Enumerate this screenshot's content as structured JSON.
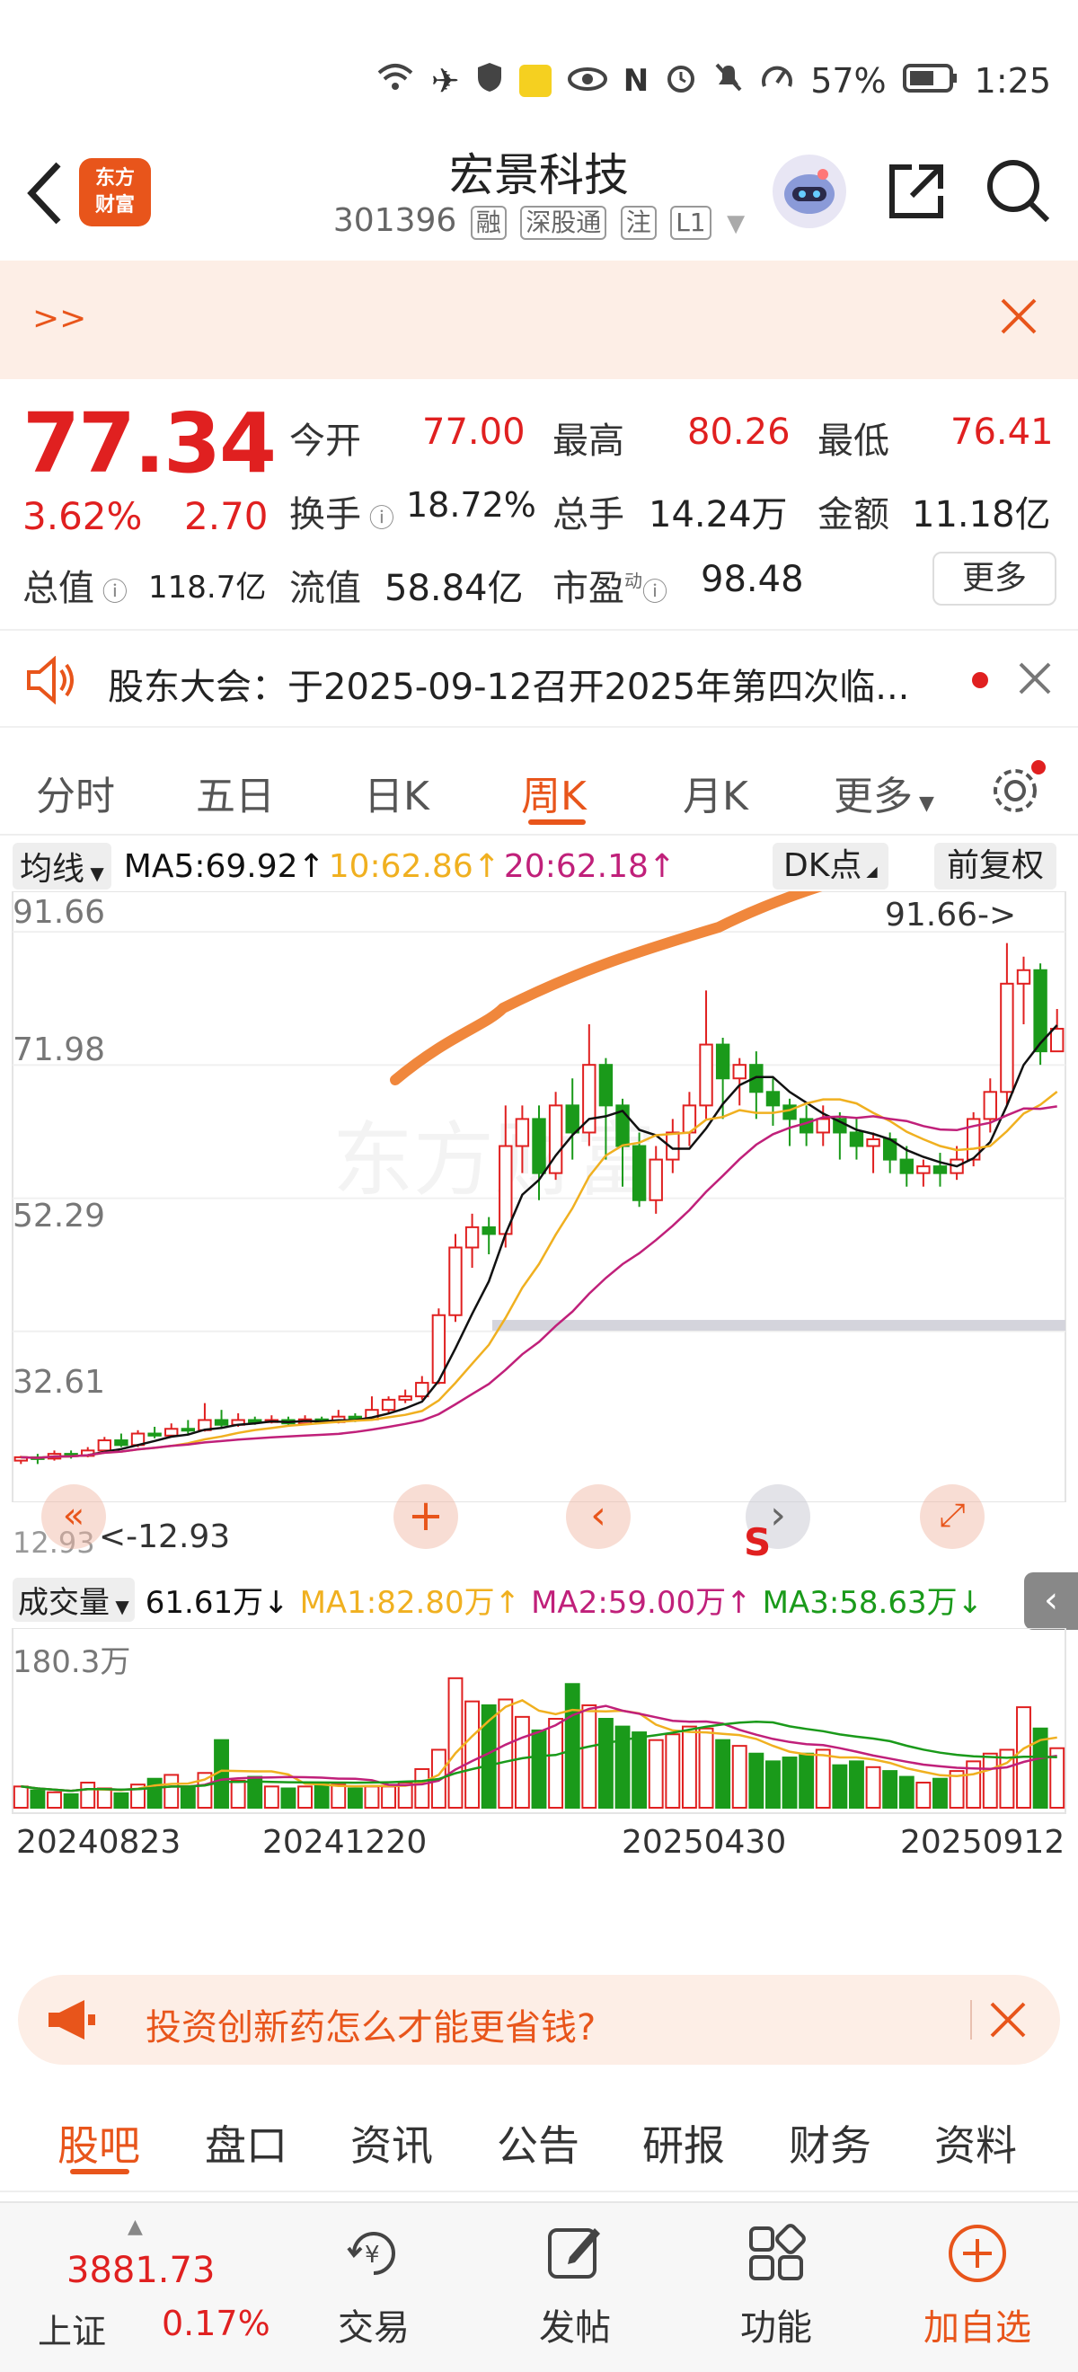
{
  "status_bar": {
    "battery": "57%",
    "time": "1:25"
  },
  "header": {
    "stock_name": "宏景科技",
    "stock_code": "301396",
    "tags": [
      "融",
      "深股通",
      "注",
      "L1"
    ],
    "logo_text": "东方财富"
  },
  "promo": {
    "text": ">>"
  },
  "quote": {
    "price": "77.34",
    "change_pct": "3.62%",
    "change": "2.70",
    "open_label": "今开",
    "open": "77.00",
    "high_label": "最高",
    "high": "80.26",
    "low_label": "最低",
    "low": "76.41",
    "turnover_label": "换手",
    "turnover": "18.72%",
    "volume_label": "总手",
    "volume": "14.24万",
    "amount_label": "金额",
    "amount": "11.18亿",
    "mktcap_label": "总值",
    "mktcap": "118.7亿",
    "float_label": "流值",
    "float": "58.84亿",
    "pe_label": "市盈",
    "pe_sup": "动",
    "pe": "98.48",
    "more": "更多"
  },
  "notice": {
    "text": "股东大会：于2025-09-12召开2025年第四次临..."
  },
  "tabs": [
    "分时",
    "五日",
    "日K",
    "周K",
    "月K",
    "更多"
  ],
  "active_tab": "周K",
  "chart_header": {
    "indicator": "均线",
    "ma5": "MA5:69.92↑",
    "ma10": "10:62.86↑",
    "ma20": "20:62.18↑",
    "dk": "DK点",
    "adjust": "前复权"
  },
  "price_axis": [
    "91.66",
    "71.98",
    "52.29",
    "32.61"
  ],
  "annotations": {
    "high_marker": "91.66->",
    "low_marker": "<-12.93",
    "low_value": "12.93",
    "signal": "S"
  },
  "volume_header": {
    "label": "成交量",
    "value": "61.61万↓",
    "ma1": "MA1:82.80万↑",
    "ma2": "MA2:59.00万↑",
    "ma3": "MA3:58.63万↓"
  },
  "volume_axis": "180.3万",
  "date_axis": [
    "20240823",
    "20241220",
    "20250430",
    "20250912"
  ],
  "ad_bar": {
    "text": "投资创新药怎么才能更省钱?"
  },
  "bottom_tabs": [
    "股吧",
    "盘口",
    "资讯",
    "公告",
    "研报",
    "财务",
    "资料"
  ],
  "active_bottom_tab": "股吧",
  "nav": {
    "index_value": "3881.73",
    "index_name": "上证",
    "index_change": "0.17%",
    "trade": "交易",
    "post": "发帖",
    "function": "功能",
    "add": "加自选"
  },
  "colors": {
    "up": "#e02020",
    "down": "#1a9a1a",
    "accent": "#e8551b",
    "ma5": "#111111",
    "ma10": "#f0b020",
    "ma20": "#c0207a",
    "trend": "#f0873c"
  },
  "chart_data": {
    "type": "candlestick",
    "period": "weekly",
    "y_range": [
      12.93,
      91.66
    ],
    "x_labels": [
      "20240823",
      "20241220",
      "20250430",
      "20250912"
    ],
    "candles": [
      [
        13.5,
        14,
        13,
        14.2
      ],
      [
        14,
        13.8,
        13,
        14.5
      ],
      [
        13.8,
        14.5,
        13.5,
        15
      ],
      [
        14.5,
        14.2,
        13.8,
        15
      ],
      [
        14.2,
        15,
        14,
        15.5
      ],
      [
        15,
        16.5,
        14.8,
        17
      ],
      [
        16.5,
        15.8,
        15.5,
        17.5
      ],
      [
        15.8,
        17.5,
        15.5,
        18
      ],
      [
        17.5,
        17.2,
        16.8,
        18.5
      ],
      [
        17.2,
        18.2,
        17,
        19
      ],
      [
        18.2,
        18,
        17.5,
        19.5
      ],
      [
        18,
        19.5,
        17.8,
        22
      ],
      [
        19.5,
        18.8,
        18.5,
        21
      ],
      [
        18.8,
        19.5,
        18.5,
        20.5
      ],
      [
        19.5,
        19.2,
        18.8,
        20
      ],
      [
        19.2,
        19.5,
        19,
        20.2
      ],
      [
        19.5,
        19,
        18.8,
        20
      ],
      [
        19,
        19.6,
        18.8,
        20.2
      ],
      [
        19.6,
        19.2,
        19,
        20
      ],
      [
        19.2,
        20,
        19,
        21
      ],
      [
        20,
        19.6,
        19.2,
        20.5
      ],
      [
        19.6,
        21,
        19.5,
        23
      ],
      [
        21,
        22.5,
        20.5,
        23
      ],
      [
        22.5,
        23,
        22,
        24
      ],
      [
        23,
        25,
        22.5,
        26
      ],
      [
        25,
        35,
        24.8,
        36
      ],
      [
        35,
        45,
        34,
        47
      ],
      [
        45,
        48,
        42,
        50
      ],
      [
        48,
        47,
        44,
        49.5
      ],
      [
        47,
        60,
        45,
        66
      ],
      [
        60,
        64,
        56,
        66
      ],
      [
        64,
        56,
        52,
        66
      ],
      [
        56,
        66,
        55,
        68
      ],
      [
        66,
        62,
        58,
        70
      ],
      [
        62,
        72,
        60,
        78
      ],
      [
        72,
        66,
        58,
        73
      ],
      [
        66,
        60,
        54,
        67
      ],
      [
        60,
        52,
        51,
        62
      ],
      [
        52,
        58,
        50,
        60
      ],
      [
        58,
        62,
        56,
        64
      ],
      [
        62,
        66,
        60,
        68
      ],
      [
        66,
        75,
        64,
        83
      ],
      [
        75,
        70,
        64,
        76
      ],
      [
        70,
        72,
        66,
        73
      ],
      [
        72,
        68,
        64,
        74
      ],
      [
        68,
        66,
        63,
        70
      ],
      [
        66,
        64,
        60,
        67
      ],
      [
        64,
        62,
        60,
        66
      ],
      [
        62,
        64,
        60,
        66
      ],
      [
        64,
        62,
        58,
        65
      ],
      [
        62,
        60,
        58,
        64
      ],
      [
        60,
        61,
        56,
        62
      ],
      [
        61,
        58,
        56,
        62
      ],
      [
        58,
        56,
        54,
        60
      ],
      [
        56,
        57,
        54,
        58
      ],
      [
        57,
        56,
        54,
        59
      ],
      [
        56,
        58,
        55,
        60
      ],
      [
        58,
        64,
        57,
        65
      ],
      [
        64,
        68,
        62,
        70
      ],
      [
        68,
        84,
        66,
        90
      ],
      [
        84,
        86,
        78,
        88
      ],
      [
        86,
        74,
        72,
        87
      ],
      [
        74,
        77.34,
        76.41,
        80.26
      ]
    ],
    "volume": [
      22,
      18,
      16,
      14,
      26,
      20,
      15,
      24,
      30,
      34,
      22,
      36,
      70,
      28,
      32,
      22,
      20,
      22,
      25,
      24,
      20,
      22,
      22,
      26,
      40,
      60,
      134,
      110,
      106,
      112,
      94,
      80,
      92,
      128,
      106,
      92,
      84,
      78,
      70,
      76,
      84,
      82,
      70,
      64,
      56,
      48,
      52,
      56,
      60,
      44,
      48,
      42,
      38,
      32,
      26,
      30,
      38,
      48,
      56,
      60,
      104,
      82,
      61.61
    ],
    "volume_max": 180.3,
    "volume_unit": "万"
  }
}
